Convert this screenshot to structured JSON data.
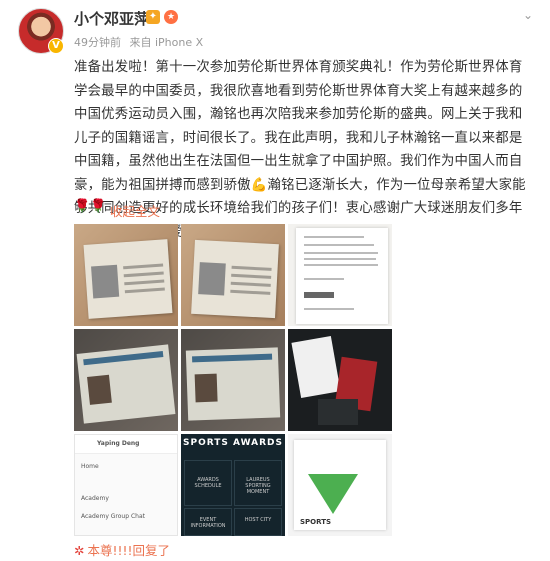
{
  "post": {
    "username": "小个邓亚萍",
    "verified_badge": "V",
    "meta_time": "49分钟前",
    "meta_source": "来自 iPhone X",
    "content": "准备出发啦！第十一次参加劳伦斯世界体育颁奖典礼！作为劳伦斯世界体育学会最早的中国委员，我很欣喜地看到劳伦斯世界体育大奖上有越来越多的中国优秀运动员入围，瀚铭也再次陪我来参加劳伦斯的盛典。网上关于我和儿子的国籍谣言，时间很长了。我在此声明，我和儿子林瀚铭一直以来都是中国籍，虽然他出生在法国但一出生就拿了中国护照。我们作为中国人而自豪，能为祖国拼搏而感到骄傲💪瀚铭已逐渐长大，作为一位母亲希望大家能够共同创造更好的成长环境给我们的孩子们！衷心感谢广大球迷朋友们多年来一直对我的关爱和支持！🙏🙏",
    "roses": "🌹🌹",
    "collapse_label": "收起全文",
    "expand_icon": "chevron-down-icon",
    "footer_hub": "✲",
    "footer_text": "本尊!!!!回复了"
  },
  "images": {
    "app_name": "Yaping Deng",
    "app_items": [
      "Home",
      "Academy",
      "Academy Group Chat"
    ],
    "sports_title": "SPORTS AWARDS",
    "sports_tiles": [
      "AWARDS SCHEDULE",
      "LAUREUS SPORTING MOMENT",
      "EVENT INFORMATION",
      "HOST CITY"
    ],
    "sportsdoc_title": "SPORTS"
  }
}
